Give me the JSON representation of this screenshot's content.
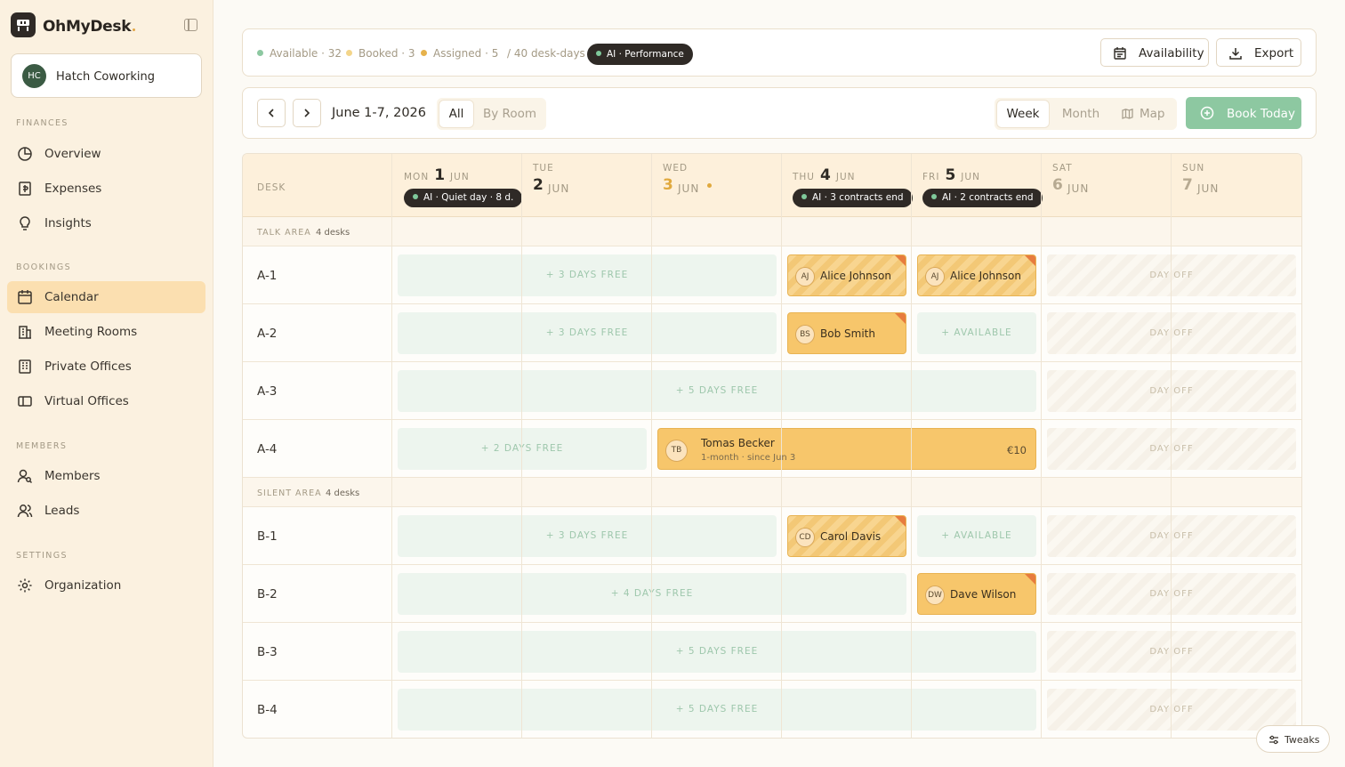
{
  "app": {
    "brand": "OhMyDesk"
  },
  "workspace": {
    "initials": "HC",
    "name": "Hatch Coworking"
  },
  "sidebar": {
    "finances_title": "FINANCES",
    "overview": "Overview",
    "expenses": "Expenses",
    "insights": "Insights",
    "bookings_title": "BOOKINGS",
    "calendar": "Calendar",
    "meeting_rooms": "Meeting Rooms",
    "private_offices": "Private Offices",
    "virtual_offices": "Virtual Offices",
    "members_title": "MEMBERS",
    "members": "Members",
    "leads": "Leads",
    "settings_title": "SETTINGS",
    "organization": "Organization"
  },
  "stats": {
    "available": "Available · 32",
    "booked": "Booked · 3",
    "assigned": "Assigned · 5",
    "total": "/ 40 desk-days",
    "ai_badge": "AI · Performance"
  },
  "toolbar": {
    "availability": "Availability",
    "export": "Export",
    "date_range": "June 1-7, 2026",
    "filter_all": "All",
    "filter_room": "By Room",
    "view_week": "Week",
    "view_month": "Month",
    "view_map": "Map",
    "book_today": "Book Today"
  },
  "grid": {
    "desk_header": "DESK",
    "days": [
      {
        "dow": "MON",
        "num": "1",
        "mon": "JUN",
        "badge": "AI · Quiet day · 8 d."
      },
      {
        "dow": "TUE",
        "num": "2",
        "mon": "JUN"
      },
      {
        "dow": "WED",
        "num": "3",
        "mon": "JUN"
      },
      {
        "dow": "THU",
        "num": "4",
        "mon": "JUN",
        "badge": "AI · 3 contracts end"
      },
      {
        "dow": "FRI",
        "num": "5",
        "mon": "JUN",
        "badge": "AI · 2 contracts end"
      },
      {
        "dow": "SAT",
        "num": "6",
        "mon": "JUN"
      },
      {
        "dow": "SUN",
        "num": "7",
        "mon": "JUN"
      }
    ],
    "areas": [
      {
        "name": "TALK AREA",
        "count": "4 desks"
      },
      {
        "name": "SILENT AREA",
        "count": "4 desks"
      }
    ],
    "desks": [
      "A-1",
      "A-2",
      "A-3",
      "A-4",
      "B-1",
      "B-2",
      "B-3",
      "B-4"
    ],
    "free3": "+ 3 DAYS FREE",
    "free5": "+ 5 DAYS FREE",
    "free2": "+ 2 DAYS FREE",
    "free4": "+ 4 DAYS FREE",
    "available": "+ AVAILABLE",
    "day_off": "DAY OFF",
    "bookings": {
      "a1_thu": {
        "initials": "AJ",
        "name": "Alice Johnson"
      },
      "a1_fri": {
        "initials": "AJ",
        "name": "Alice Johnson"
      },
      "a2_thu": {
        "initials": "BS",
        "name": "Bob Smith"
      },
      "a4": {
        "initials": "TB",
        "name": "Tomas Becker",
        "sub": "1-month · since Jun 3",
        "price": "€10"
      },
      "b1_thu": {
        "initials": "CD",
        "name": "Carol Davis"
      },
      "b2_fri": {
        "initials": "DW",
        "name": "Dave Wilson"
      }
    }
  },
  "tweaks": "Tweaks",
  "colors": {
    "accent": "#f7c66b",
    "green": "#8dc8a1",
    "dark": "#2f2a26"
  }
}
